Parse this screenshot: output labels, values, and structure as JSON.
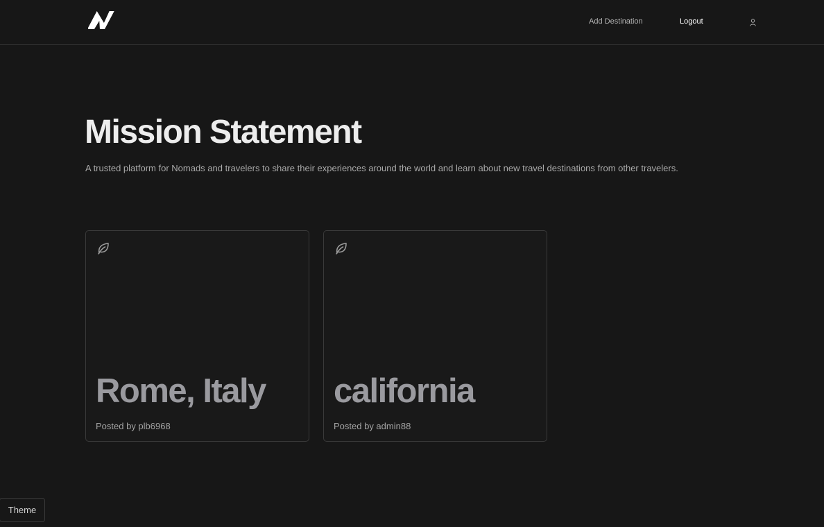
{
  "header": {
    "logo_icon": "brand-n-logo-icon",
    "nav": {
      "add_destination_label": "Add Destination",
      "logout_label": "Logout"
    },
    "user_icon": "user-icon"
  },
  "hero": {
    "title": "Mission Statement",
    "subtitle": "A trusted platform for Nomads and travelers to share their experiences around the world and learn about new travel destinations from other travelers."
  },
  "destinations": [
    {
      "icon": "leaf-icon",
      "title": "Rome, Italy",
      "posted_by": "Posted by plb6968"
    },
    {
      "icon": "leaf-icon",
      "title": "california",
      "posted_by": "Posted by admin88"
    }
  ],
  "theme_button": {
    "label": "Theme"
  },
  "colors": {
    "background": "#171717",
    "border": "#333333",
    "card_title": "#9a9a9f",
    "text_muted": "#a9a9a9"
  }
}
